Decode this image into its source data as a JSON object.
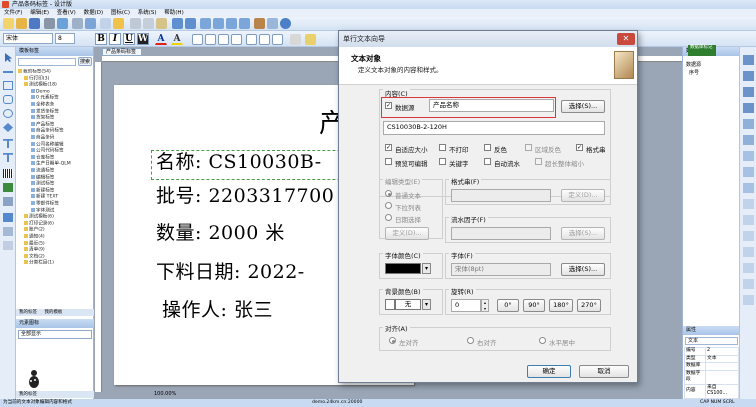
{
  "window": {
    "title": "产品条码标签 - 设计版"
  },
  "menu": [
    "文件(F)",
    "编辑(E)",
    "查看(V)",
    "数据(D)",
    "图标(C)",
    "系统(S)",
    "帮助(H)"
  ],
  "toolbar2": {
    "font_name": "宋体",
    "font_size": "8",
    "bold": "B",
    "italic": "I",
    "underline": "U",
    "wordart": "W",
    "font_color": "A",
    "highlight": "A"
  },
  "leftpanel": {
    "title": "模板标签",
    "search_button": "搜索",
    "tree": [
      "我的标签(54)",
      "行打印(3)",
      "测试模板(18)",
      "Demo",
      "0 元素标签",
      "全称表条",
      "发货条标签",
      "货架标签",
      "产品标签",
      "商品条码标签",
      "商品条码",
      "公司名称编辑",
      "公司代码标签",
      "仓库标签",
      "生产日期单-QLM",
      "流通标签",
      "编辑标签",
      "测试标签",
      "新建标签",
      "新建 TEXT",
      "零部件标签",
      "字体测试",
      "测试模板(6)",
      "打印记录(6)",
      "账户(2)",
      "通知(4)",
      "最近(5)",
      "清单(9)",
      "文档(2)",
      "分类栏目(1)"
    ],
    "tabs": [
      "我的标签",
      "我的模板"
    ],
    "preview_title": "元素图标",
    "preview_select": "全部显示"
  },
  "canvas": {
    "doc_tab": "产品条码标签",
    "lines": {
      "title_fragment": "产",
      "name": "名称: CS10030B-",
      "batch": "批号: 2203317700",
      "qty": "数量: 2000  米",
      "date": "下料日期: 2022-",
      "operator": "操作人: 张三"
    },
    "zoom": "100.00%"
  },
  "rightpanel": {
    "title": "数据库",
    "db_button": "数据库标记",
    "sub": "数据源",
    "items": [
      "序号"
    ],
    "props_title": "属性",
    "props_tab": "文本",
    "props": [
      [
        "编号",
        "2"
      ],
      [
        "类型",
        "文本"
      ],
      [
        "数据库",
        ""
      ],
      [
        "数据字段",
        ""
      ],
      [
        "内容",
        "来自 CS100..."
      ]
    ]
  },
  "status": {
    "left": "为当前的文本对象编辑内容和格式",
    "mid": "demo.24km.cn:20000",
    "right": "CAP  NUM  SCRL"
  },
  "dialog": {
    "title": "单行文本向导",
    "header_title": "文本对象",
    "header_sub": "定义文本对象的内容和样式。",
    "content_label": "内容(C)",
    "datasource_label": "数据源",
    "datasource_value": "产品名称",
    "select_button": "选择(S)...",
    "content_value": "CS10030B-2-120H",
    "checks": [
      {
        "label": "自适应大小",
        "checked": true,
        "disabled": false
      },
      {
        "label": "不打印",
        "checked": false,
        "disabled": false
      },
      {
        "label": "反色",
        "checked": false,
        "disabled": false
      },
      {
        "label": "区域反色",
        "checked": false,
        "disabled": true
      },
      {
        "label": "格式串",
        "checked": true,
        "disabled": false
      },
      {
        "label": "预览可编辑",
        "checked": false,
        "disabled": false
      },
      {
        "label": "关键字",
        "checked": false,
        "disabled": false
      },
      {
        "label": "自动流水",
        "checked": false,
        "disabled": false
      },
      {
        "label": "超长整体缩小",
        "checked": false,
        "disabled": true
      }
    ],
    "edit_type_label": "编辑类型(E)",
    "edit_types": [
      "普通文本",
      "下拉列表",
      "日期选择"
    ],
    "define_button": "定义(D)...",
    "format_label": "格式串(F)",
    "format_define_button": "定义(D)...",
    "serial_label": "流水因子(F)",
    "serial_select_button": "选择(S)...",
    "font_color_label": "字体颜色(C)",
    "font_label": "字体(F)",
    "font_value": "宋体(8pt)",
    "font_select_button": "选择(S)...",
    "bg_color_label": "背景颜色(B)",
    "bg_color_value": "无",
    "rotate_label": "旋转(R)",
    "rotate_value": "0",
    "rotate_buttons": [
      "0°",
      "90°",
      "180°",
      "270°"
    ],
    "align_label": "对齐(A)",
    "align_options": [
      "左对齐",
      "右对齐",
      "水平居中"
    ],
    "ok_button": "确定",
    "cancel_button": "取消"
  }
}
